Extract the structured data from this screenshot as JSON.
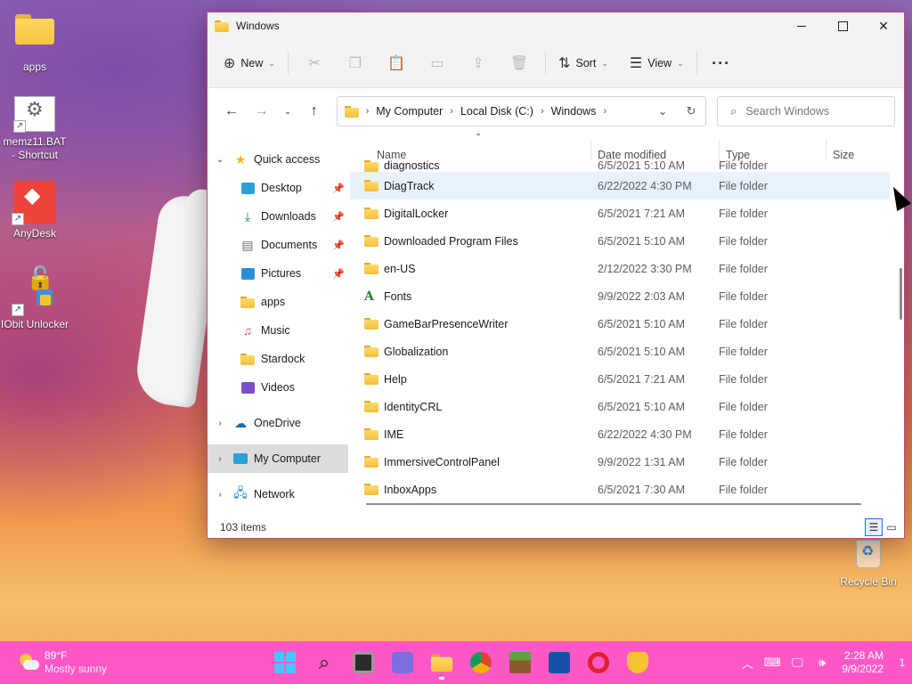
{
  "desktop": {
    "icons": [
      {
        "label": "apps"
      },
      {
        "label": "memz11.BAT - Shortcut"
      },
      {
        "label": "AnyDesk"
      },
      {
        "label": "IObit Unlocker"
      },
      {
        "label": "Recycle Bin"
      }
    ]
  },
  "window": {
    "title": "Windows",
    "toolbar": {
      "new_label": "New",
      "sort_label": "Sort",
      "view_label": "View"
    },
    "address": {
      "crumbs": [
        "My Computer",
        "Local Disk (C:)",
        "Windows"
      ]
    },
    "search": {
      "placeholder": "Search Windows"
    },
    "nav": {
      "quick_access": "Quick access",
      "pinned": [
        {
          "label": "Desktop",
          "pinned": true
        },
        {
          "label": "Downloads",
          "pinned": true
        },
        {
          "label": "Documents",
          "pinned": true
        },
        {
          "label": "Pictures",
          "pinned": true
        },
        {
          "label": "apps",
          "pinned": false
        },
        {
          "label": "Music",
          "pinned": false
        },
        {
          "label": "Stardock",
          "pinned": false
        },
        {
          "label": "Videos",
          "pinned": false
        }
      ],
      "onedrive": "OneDrive",
      "my_computer": "My Computer",
      "network": "Network"
    },
    "columns": {
      "name": "Name",
      "date": "Date modified",
      "type": "Type",
      "size": "Size"
    },
    "files": [
      {
        "name": "diagnostics",
        "date": "6/5/2021 5:10 AM",
        "type": "File folder"
      },
      {
        "name": "DiagTrack",
        "date": "6/22/2022 4:30 PM",
        "type": "File folder"
      },
      {
        "name": "DigitalLocker",
        "date": "6/5/2021 7:21 AM",
        "type": "File folder"
      },
      {
        "name": "Downloaded Program Files",
        "date": "6/5/2021 5:10 AM",
        "type": "File folder"
      },
      {
        "name": "en-US",
        "date": "2/12/2022 3:30 PM",
        "type": "File folder"
      },
      {
        "name": "Fonts",
        "date": "9/9/2022 2:03 AM",
        "type": "File folder"
      },
      {
        "name": "GameBarPresenceWriter",
        "date": "6/5/2021 5:10 AM",
        "type": "File folder"
      },
      {
        "name": "Globalization",
        "date": "6/5/2021 5:10 AM",
        "type": "File folder"
      },
      {
        "name": "Help",
        "date": "6/5/2021 7:21 AM",
        "type": "File folder"
      },
      {
        "name": "IdentityCRL",
        "date": "6/5/2021 5:10 AM",
        "type": "File folder"
      },
      {
        "name": "IME",
        "date": "6/22/2022 4:30 PM",
        "type": "File folder"
      },
      {
        "name": "ImmersiveControlPanel",
        "date": "9/9/2022 1:31 AM",
        "type": "File folder"
      },
      {
        "name": "InboxApps",
        "date": "6/5/2021 7:30 AM",
        "type": "File folder"
      }
    ],
    "status": {
      "item_count": "103 items"
    }
  },
  "taskbar": {
    "weather_temp": "89°F",
    "weather_cond": "Mostly sunny",
    "time": "2:28 AM",
    "date": "9/9/2022",
    "notification_count": "1"
  }
}
